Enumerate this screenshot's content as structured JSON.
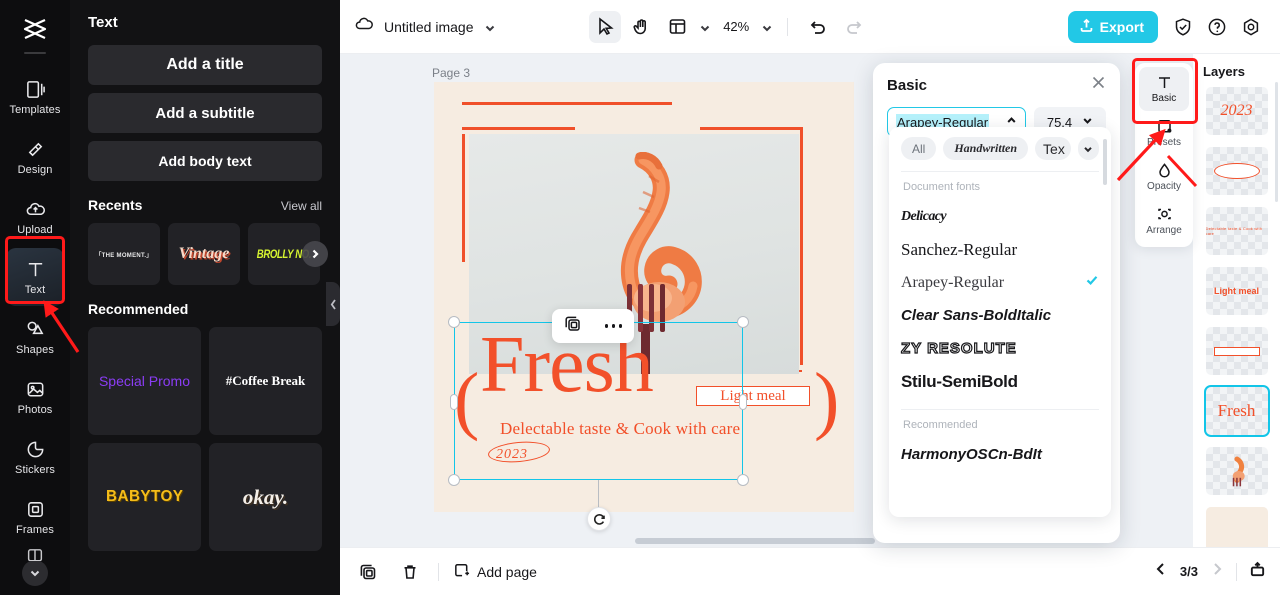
{
  "app": {
    "name": "CapCut",
    "logo_icon": "capcut-logo-icon"
  },
  "rail": {
    "items": [
      {
        "label": "Templates",
        "icon": "templates-icon"
      },
      {
        "label": "Design",
        "icon": "design-icon"
      },
      {
        "label": "Upload",
        "icon": "upload-cloud-icon"
      },
      {
        "label": "Text",
        "icon": "text-t-icon",
        "active": true
      },
      {
        "label": "Shapes",
        "icon": "shapes-icon"
      },
      {
        "label": "Photos",
        "icon": "photos-icon"
      },
      {
        "label": "Stickers",
        "icon": "stickers-icon"
      },
      {
        "label": "Frames",
        "icon": "frames-icon"
      }
    ],
    "more_label": "chevron-down-icon"
  },
  "panel": {
    "title": "Text",
    "buttons": [
      {
        "label": "Add a title"
      },
      {
        "label": "Add a subtitle"
      },
      {
        "label": "Add body text"
      }
    ],
    "recents": {
      "heading": "Recents",
      "view_all": "View all",
      "items": [
        {
          "label": "「THE MOMENT.」"
        },
        {
          "label": "Vintage"
        },
        {
          "label": "BROLLY NO."
        }
      ]
    },
    "recommended": {
      "heading": "Recommended",
      "items": [
        {
          "label": "Special Promo",
          "color": "#8b3df5"
        },
        {
          "label": "#Coffee Break",
          "color": "#ffffff"
        },
        {
          "label": "BABYTOY",
          "color": "#f5bd19"
        },
        {
          "label": "okay.",
          "color": "#f4efe8"
        }
      ]
    }
  },
  "topbar": {
    "cloud_icon": "cloud-sync-icon",
    "doc_title": "Untitled image",
    "doc_chevron": "chevron-down-icon",
    "tools": [
      {
        "name": "select-tool",
        "icon": "cursor-arrow-icon",
        "selected": true
      },
      {
        "name": "hand-tool",
        "icon": "hand-icon",
        "selected": false
      },
      {
        "name": "layout-tool",
        "icon": "layout-grid-icon",
        "selected": false
      }
    ],
    "zoom": "42%",
    "undo_icon": "undo-arrow-icon",
    "redo_icon": "redo-arrow-icon",
    "export_label": "Export",
    "export_icon": "export-upload-icon",
    "export_color": "#22c8e6",
    "right_icons": [
      {
        "name": "shield-check-icon"
      },
      {
        "name": "help-question-icon"
      },
      {
        "name": "settings-gear-icon"
      }
    ]
  },
  "canvas": {
    "page_label": "Page 3",
    "page_tools": [
      {
        "name": "duplicate-page-icon"
      },
      {
        "name": "page-more-icon"
      }
    ],
    "design": {
      "background": "#f6ece1",
      "accent": "#f2502a",
      "title": "Fresh",
      "subtitle": "Delectable taste & Cook with care",
      "year": "2023",
      "badge": "Light meal"
    },
    "floating_toolbar": [
      {
        "name": "duplicate-icon"
      },
      {
        "name": "more-options-icon"
      }
    ],
    "selection": {
      "color": "#12c5e8",
      "rotate_icon": "rotate-icon"
    }
  },
  "font_panel": {
    "title": "Basic",
    "close_icon": "close-icon",
    "font_name": "Arapey-Regular",
    "font_size": "75.4",
    "font_chevron": "chevron-up-icon",
    "size_chevron": "chevron-down-icon",
    "filters": [
      {
        "label": "All",
        "active": true
      },
      {
        "label": "Handwritten",
        "active": false
      },
      {
        "label": "Tex",
        "active": false
      }
    ],
    "filter_more_icon": "chevron-down-icon",
    "groups": [
      {
        "label": "Document fonts",
        "fonts": [
          {
            "name": "Delicacy",
            "selected": false,
            "style": "f-delicacy"
          },
          {
            "name": "Sanchez-Regular",
            "selected": false,
            "style": "f-sanchez"
          },
          {
            "name": "Arapey-Regular",
            "selected": true,
            "style": "f-arapey"
          },
          {
            "name": "Clear Sans-BoldItalic",
            "selected": false,
            "style": "f-clear"
          },
          {
            "name": "ZY RESOLUTE",
            "selected": false,
            "style": "f-zy"
          },
          {
            "name": "Stilu-SemiBold",
            "selected": false,
            "style": "f-stilu"
          }
        ]
      },
      {
        "label": "Recommended",
        "fonts": [
          {
            "name": "HarmonyOSCn-BdIt",
            "selected": false,
            "style": "f-harmony"
          }
        ]
      }
    ],
    "check_color": "#22c8e6"
  },
  "right_rail": {
    "items": [
      {
        "label": "Basic",
        "icon": "text-t-icon",
        "active": true
      },
      {
        "label": "Presets",
        "icon": "presets-star-icon",
        "active": false
      },
      {
        "label": "Opacity",
        "icon": "opacity-drop-icon",
        "active": false
      },
      {
        "label": "Arrange",
        "icon": "arrange-icon",
        "active": false
      }
    ]
  },
  "layers": {
    "title": "Layers",
    "items": [
      {
        "name": "2023",
        "type": "text",
        "selected": false
      },
      {
        "name": "oval-shape",
        "type": "shape",
        "selected": false
      },
      {
        "name": "Delectable taste & Cook with care",
        "type": "text",
        "selected": false
      },
      {
        "name": "Light meal",
        "type": "text",
        "selected": false
      },
      {
        "name": "rectangle-shape",
        "type": "shape",
        "selected": false
      },
      {
        "name": "Fresh",
        "type": "text",
        "selected": true
      },
      {
        "name": "shrimp-image",
        "type": "image",
        "selected": false
      },
      {
        "name": "background",
        "type": "background",
        "selected": false
      }
    ]
  },
  "bottombar": {
    "duplicate_icon": "duplicate-page-icon",
    "delete_icon": "trash-icon",
    "add_page_label": "Add page",
    "add_page_icon": "add-page-icon",
    "prev_icon": "chevron-left-icon",
    "next_icon": "chevron-right-icon",
    "page_count": "3/3",
    "present_icon": "present-icon"
  },
  "annotations": {
    "highlight_color": "#ff1a1a",
    "boxes": [
      "text-rail-item",
      "basic-right-rail-item"
    ],
    "arrows": 2
  }
}
